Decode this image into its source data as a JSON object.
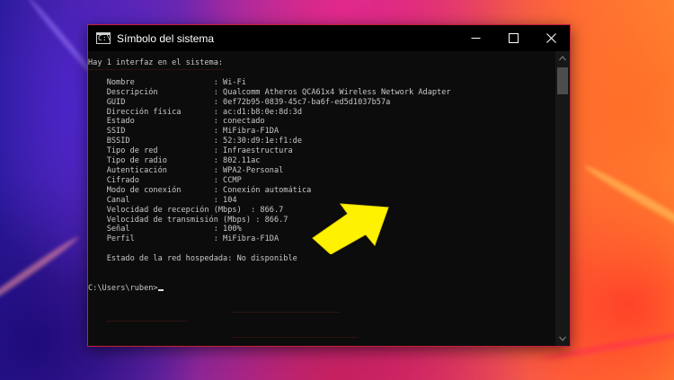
{
  "window": {
    "title": "Símbolo del sistema",
    "icon_label": "C:\\"
  },
  "console": {
    "lines": [
      "Hay 1 interfaz en el sistema:",
      "",
      "    Nombre                 : Wi-Fi",
      "    Descripción            : Qualcomm Atheros QCA61x4 Wireless Network Adapter",
      "    GUID                   : 0ef72b95-0839-45c7-ba6f-ed5d1037b57a",
      "    Dirección física       : ac:d1:b8:0e:8d:3d",
      "    Estado                 : conectado",
      "    SSID                   : MiFibra-F1DA",
      "    BSSID                  : 52:30:d9:1e:f1:de",
      "    Tipo de red            : Infraestructura",
      "    Tipo de radio          : 802.11ac",
      "    Autenticación          : WPA2-Personal",
      "    Cifrado                : CCMP",
      "    Modo de conexión       : Conexión automática",
      "    Canal                  : 104",
      "    Velocidad de recepción (Mbps)  : 866.7",
      "    Velocidad de transmisión (Mbps) : 866.7",
      "    Señal                  : 100%",
      "    Perfil                 : MiFibra-F1DA",
      "",
      "    Estado de la red hospedada: No disponible",
      "",
      "",
      "C:\\Users\\ruben>"
    ]
  },
  "colors": {
    "console_bg": "#0c0c0c",
    "console_text": "#c8c8c8",
    "window_border": "#c8203c",
    "arrow": "#fff200"
  },
  "icons": {
    "app": "cmd-icon",
    "minimize": "minimize-icon",
    "maximize": "maximize-icon",
    "close": "close-icon",
    "annotation": "arrow-annotation"
  }
}
